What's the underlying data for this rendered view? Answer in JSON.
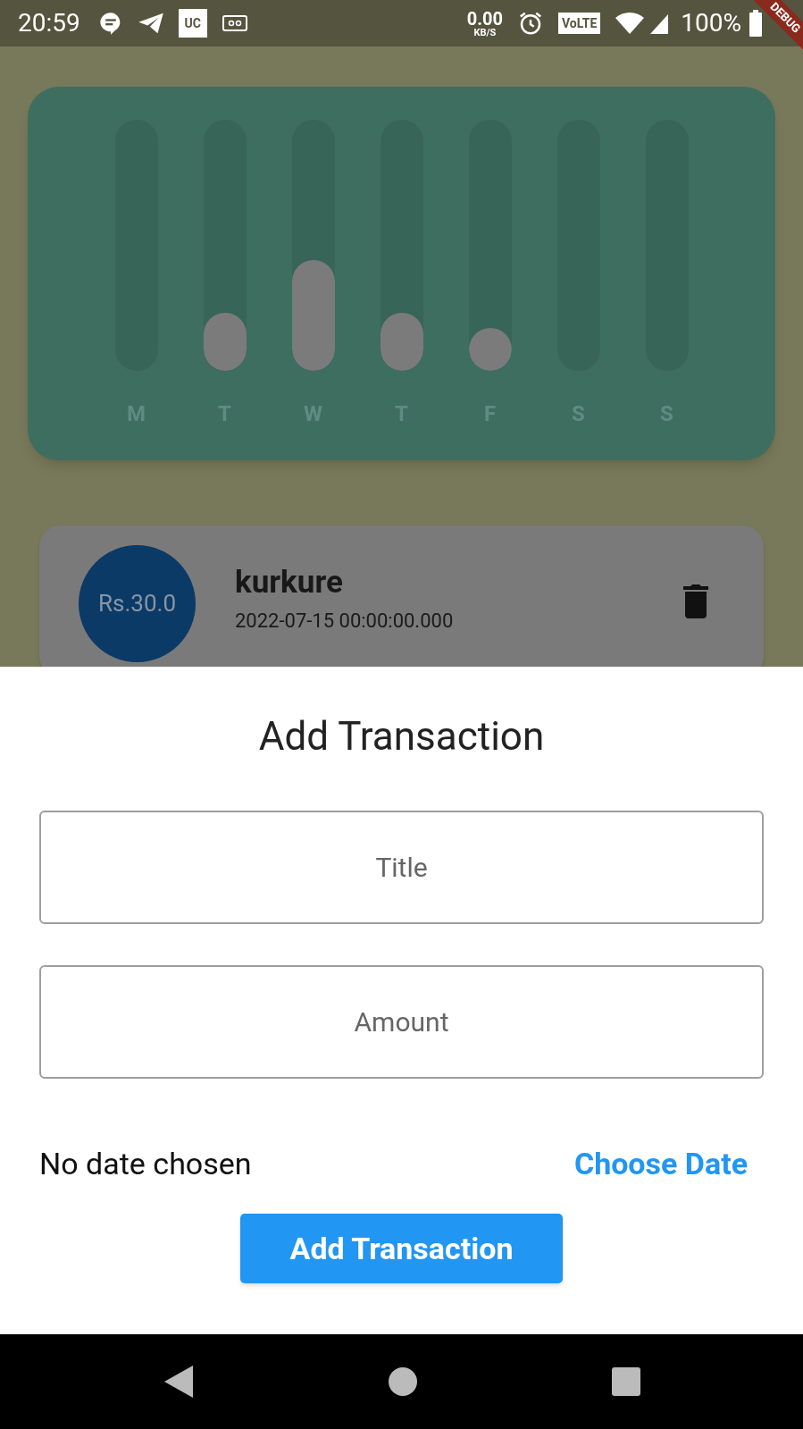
{
  "status_bar": {
    "time": "20:59",
    "uc_badge": "UC",
    "speed": "0.00",
    "speed_unit": "KB/S",
    "volte": "VoLTE",
    "battery": "100%"
  },
  "debug_banner": "DEBUG",
  "chart": {
    "days": [
      {
        "label": "M"
      },
      {
        "label": "T",
        "level": 0.23
      },
      {
        "label": "W",
        "level": 0.44
      },
      {
        "label": "T",
        "level": 0.23
      },
      {
        "label": "F",
        "level": 0.17
      },
      {
        "label": "S"
      },
      {
        "label": "S"
      }
    ]
  },
  "transactions": [
    {
      "amount": "Rs.30.0",
      "title": "kurkure",
      "date": "2022-07-15 00:00:00.000"
    }
  ],
  "sheet": {
    "title": "Add Transaction",
    "fields": [
      {
        "placeholder": "Title"
      },
      {
        "placeholder": "Amount"
      }
    ],
    "date_text": "No date chosen",
    "choose_date": "Choose Date",
    "submit": "Add Transaction"
  }
}
